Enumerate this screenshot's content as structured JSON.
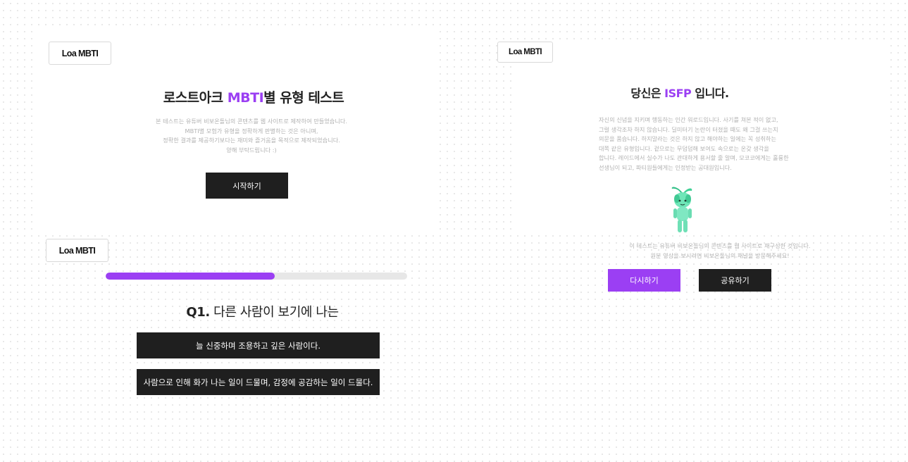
{
  "logo": {
    "text": "Loa MBTI"
  },
  "intro": {
    "title_prefix": "로스트아크 ",
    "title_accent": "MBTI",
    "title_suffix": "별 유형 테스트",
    "description": [
      "본 테스트는 유튜버 비보온돌님의 콘텐츠를 웹 사이트로 제작하여 만들었습니다.",
      "MBTI별 모험가 유형을 정확하게 판별하는 것은 아니며,",
      "정확한 결과를 제공하기보다는 재미와 즐거움을 목적으로 제작되었습니다.",
      "양해 부탁드립니다 :)"
    ],
    "start_label": "시작하기"
  },
  "question": {
    "progress": 0.56,
    "number": "Q1.",
    "text": " 다른 사람이 보기에 나는",
    "answers": [
      "늘 신중하며 조용하고 깊은 사람이다.",
      "사람으로 인해 화가 나는 일이 드물며, 감정에 공감하는 일이 드물다."
    ]
  },
  "result": {
    "title_prefix": "당신은 ",
    "type": "ISFP",
    "title_suffix": " 입니다.",
    "description": [
      "자신의 신념을 지키며 행동하는 인간 워로드입니다. 사기를 쳐본 적이 없고,",
      "그럴 생각조차 하지 않습니다. 딜미터기 논란이 터졌을 때도 왜 그걸 쓰는지",
      "의문을 품습니다. 하지말라는 것은 하지 않고 해야하는 일에는 꼭 성취하는",
      "대쪽 같은 유형입니다. 겉으로는 무덤덤해 보여도 속으로는 온갖 생각을",
      "합니다. 레이드에서 실수가 나도 관대하게 용서할 줄 알며, 모코코에게는 훌륭한",
      "선생님이 되고, 파티원들에게는 인정받는 공대원입니다."
    ],
    "note": [
      "이 테스트는 유튜버 비보온돌님의 콘텐츠를 웹 사이트로 재구성한 것입니다.",
      "원본 영상을 보시려면 비보온돌님의 채널을 방문해주세요!"
    ],
    "retry_label": "다시하기",
    "share_label": "공유하기"
  },
  "colors": {
    "accent": "#9b3ff3",
    "button_dark": "#1f1f1f",
    "character": "#5fe0b0"
  },
  "icons": {
    "character": "mokoko-character-icon"
  }
}
